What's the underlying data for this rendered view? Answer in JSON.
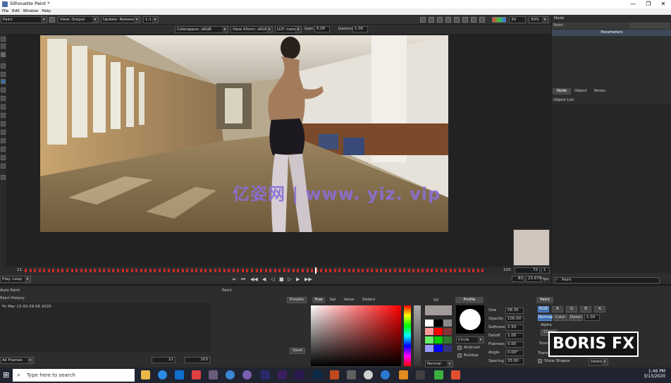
{
  "window": {
    "title": "Silhouette Paint *",
    "controls": [
      "—",
      "❐",
      "✕"
    ]
  },
  "menu": [
    "File",
    "Edit",
    "Window",
    "Help"
  ],
  "toolbar": {
    "module": "Paint",
    "view": "View: Output",
    "update": "Update: Release",
    "ratio": "1:1",
    "zoom": "30%",
    "zoom2": "30"
  },
  "toolbar2": {
    "colorspace": "Colorspace: sRGB",
    "view_xform": "View Xform: sRGB",
    "lut": "LUT: none",
    "gain_label": "Gain",
    "gain_value": "0.00",
    "gamma_label": "Gamma",
    "gamma_value": "1.00"
  },
  "timeline": {
    "start": "21",
    "end": "103",
    "current": "72",
    "step": "1",
    "current2": "83",
    "fps": "23.976",
    "fps_unit": "fps"
  },
  "playback": {
    "mode": "Play: Loop"
  },
  "right_panel": {
    "node_label": "Node",
    "node_value": "Paint",
    "parameters_tab": "Parameters",
    "tabs": [
      "Node",
      "Object",
      "Notes"
    ],
    "object_list_label": "Object List",
    "search_value": "Paint"
  },
  "auto_paint": {
    "title": "Auto Paint",
    "history_label": "Paint History",
    "history_item": "Fri Mar 13 00:39:58 2020",
    "frames_mode": "All Frames",
    "range_start": "21",
    "range_end": "103",
    "match_move": "Match Move",
    "btn1": "Replay",
    "btn2": "Detail"
  },
  "paint_panel": {
    "title": "Paint",
    "presets_btn": "Presets",
    "save_btn": "Save",
    "color_tabs": [
      "Hue",
      "Sat",
      "Value",
      "Sliders"
    ],
    "blend_mode": "Normal",
    "profile_tab": "Profile",
    "brush_shape": "Circle",
    "airbrush": "Airbrush",
    "buildup": "Buildup",
    "params": [
      {
        "name": "Size",
        "value": "58.35"
      },
      {
        "name": "Opacity",
        "value": "100.00"
      },
      {
        "name": "Softness",
        "value": "2.50"
      },
      {
        "name": "Falloff",
        "value": "1.00"
      },
      {
        "name": "Flatness",
        "value": "0.00"
      },
      {
        "name": "Angle",
        "value": "0.00°"
      },
      {
        "name": "Spacing",
        "value": "25.00"
      }
    ],
    "palette_hint": "50"
  },
  "paint_props": {
    "title": "Paint",
    "channels": [
      "RGB",
      "R",
      "G",
      "B",
      "A"
    ],
    "modes": [
      "Normal",
      "Color",
      "Detail"
    ],
    "detail_value": "1.00",
    "alpha_label": "Alpha",
    "source_label": "Source",
    "transform_label": "Transform",
    "show_shapes": "Show Shapes",
    "delete_btn": "Delete",
    "clone_btn": "Clone"
  },
  "taskbar": {
    "search_placeholder": "Type here to search",
    "time": "1:46 PM",
    "date": "3/13/2020"
  },
  "watermarks": {
    "site": "亿姿网 | www. yiz. vip",
    "logo": "BORIS FX"
  },
  "colors": {
    "accent": "#3d6fb0",
    "timeline_marks": "#c82a2a",
    "watermark": "#8a6fd6"
  }
}
